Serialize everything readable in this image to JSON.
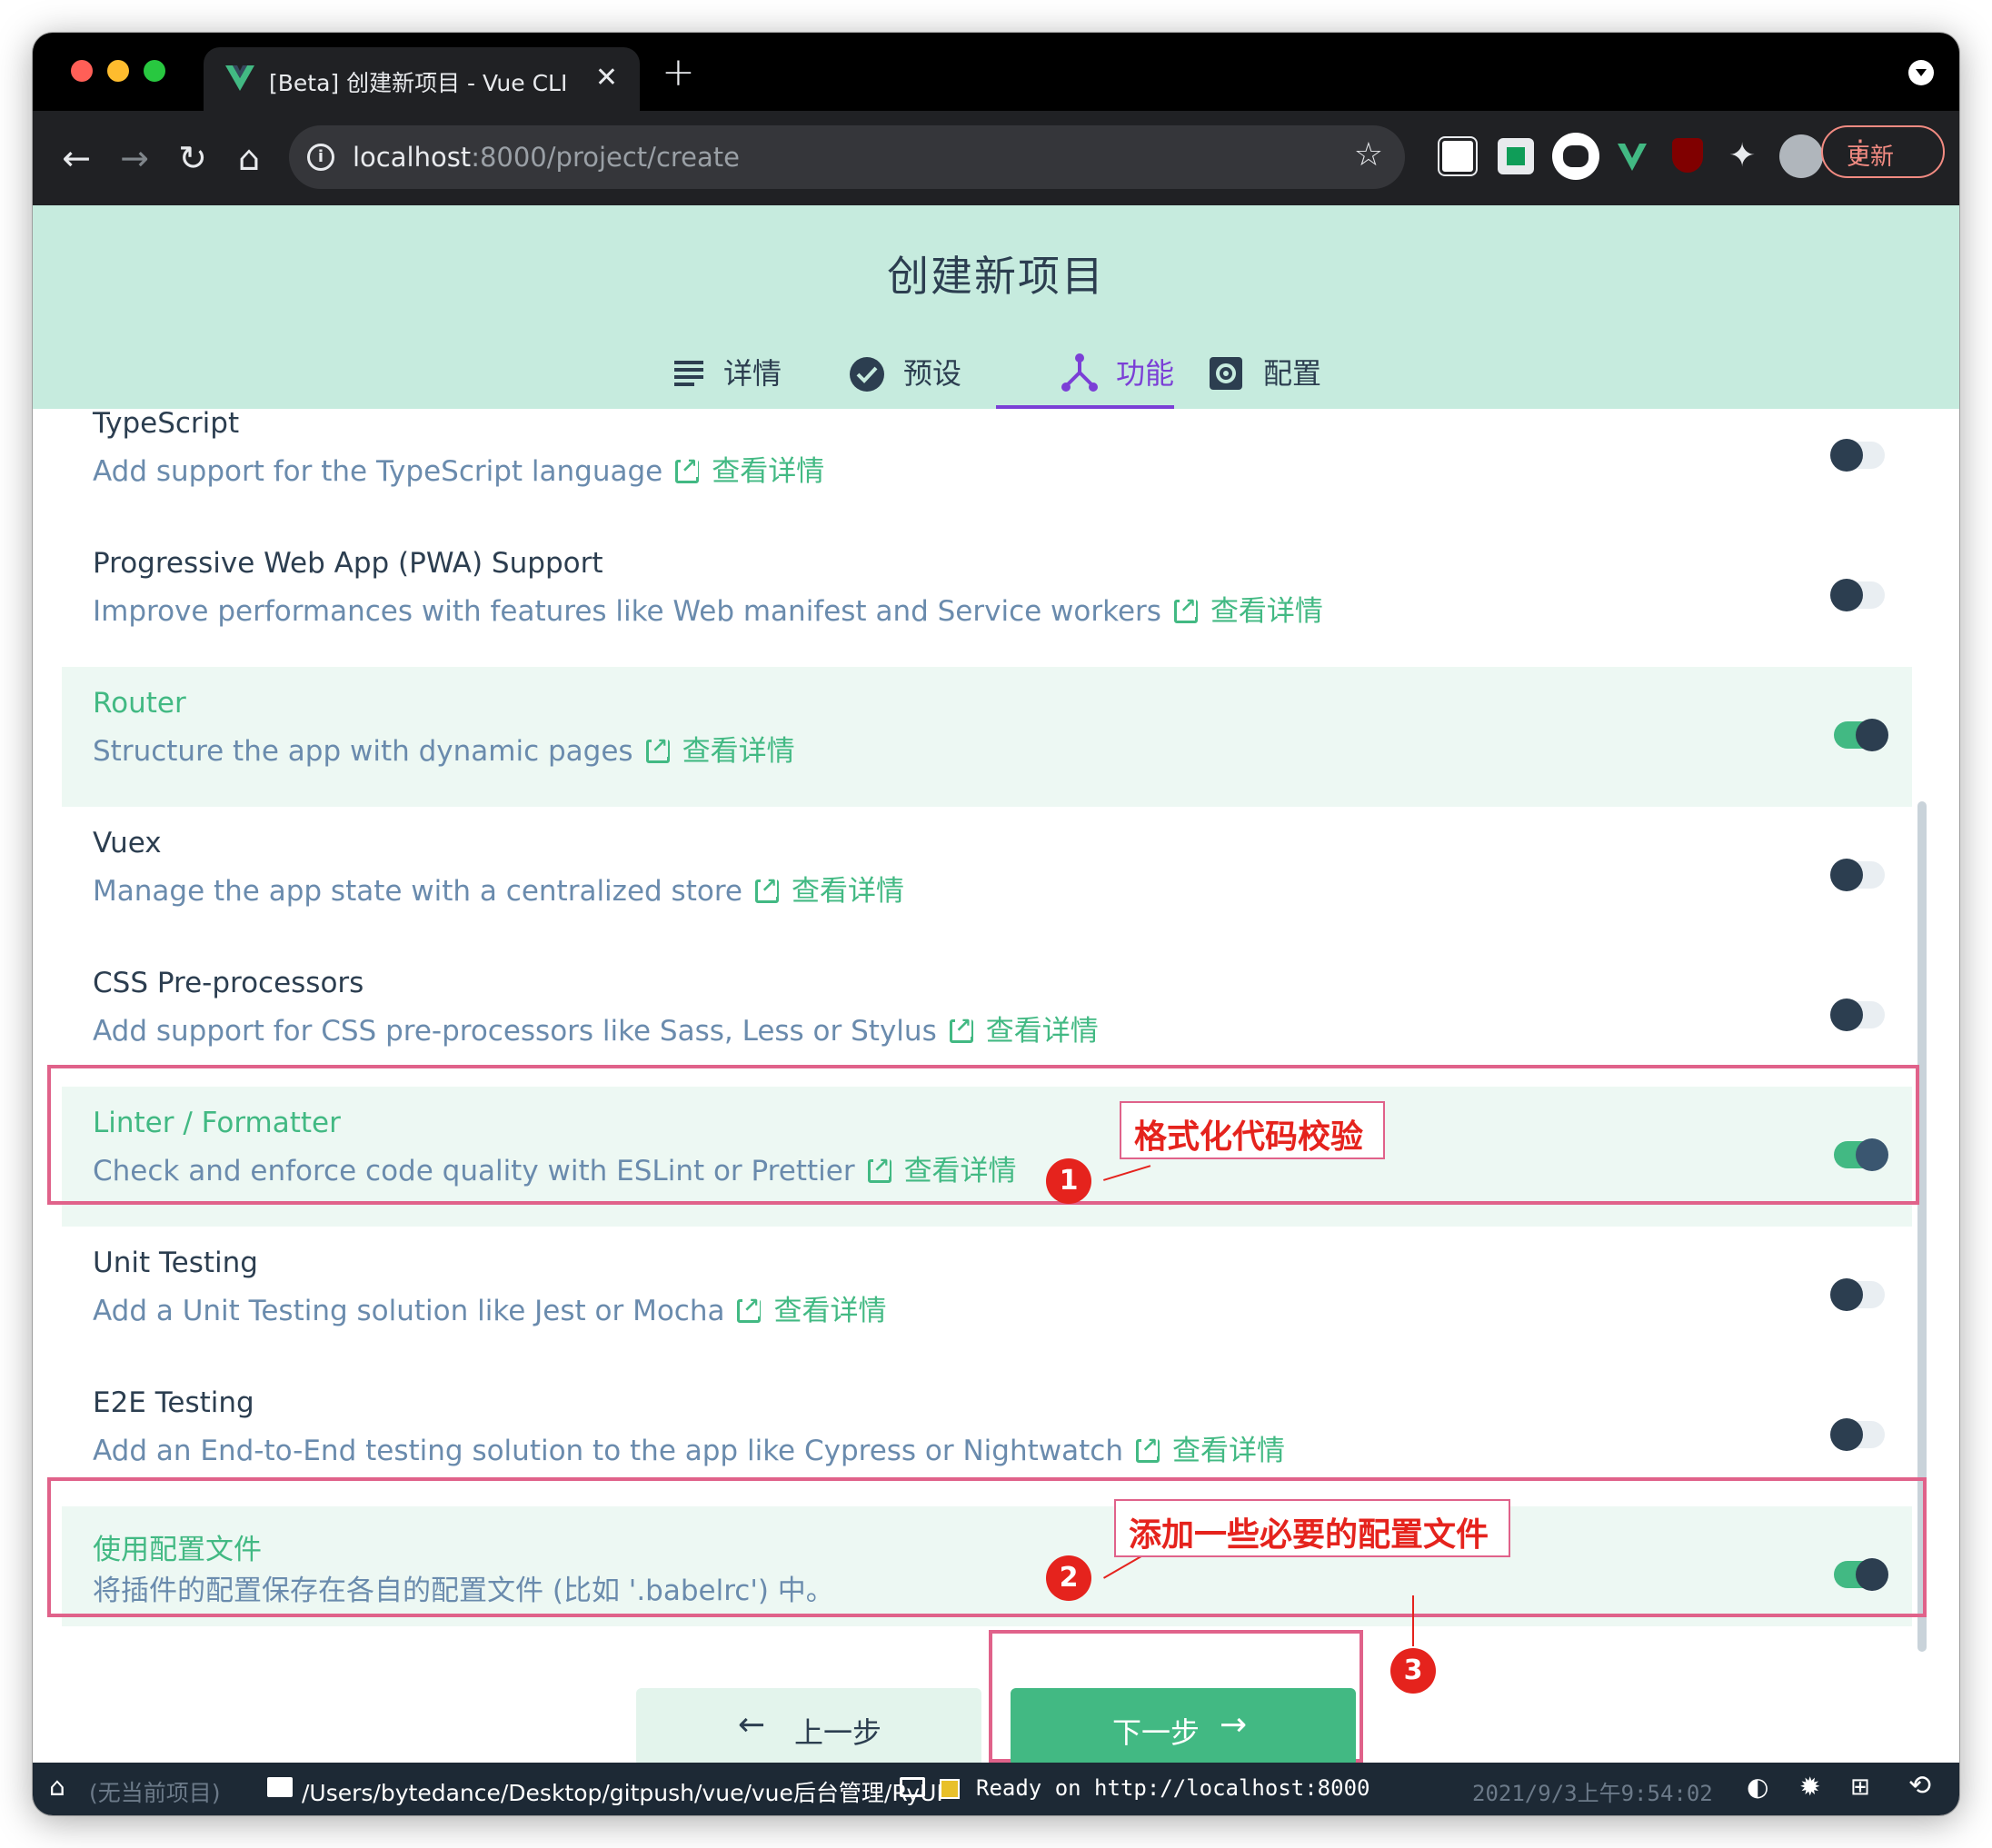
{
  "browser": {
    "tab_title": "[Beta] 创建新项目 - Vue CLI",
    "tab_close": "✕",
    "new_tab": "+",
    "url_host": "localhost",
    "url_path": ":8000/project/create",
    "update_label": "更新",
    "menu_dots": "⋮",
    "icons": [
      "back-icon",
      "forward-icon",
      "reload-icon",
      "home-icon",
      "site-info-icon",
      "bookmark-star-icon",
      "notion-extension-icon",
      "extension-icon",
      "ghost-extension-icon",
      "vue-devtools-icon",
      "ublock-icon",
      "puzzle-icon",
      "profile-avatar-icon"
    ]
  },
  "header": {
    "title": "创建新项目",
    "steps": [
      {
        "label": "详情",
        "icon": "list-icon",
        "active": false
      },
      {
        "label": "预设",
        "icon": "check-circle-icon",
        "active": false
      },
      {
        "label": "功能",
        "icon": "fork-icon",
        "active": true
      },
      {
        "label": "配置",
        "icon": "settings-icon",
        "active": false
      }
    ],
    "accent": "#7b3fd6",
    "background": "#c6ebde"
  },
  "features": {
    "more_label": "查看详情",
    "items": [
      {
        "name": "TypeScript",
        "desc": "Add support for the TypeScript language",
        "enabled": false,
        "link": true
      },
      {
        "name": "Progressive Web App (PWA) Support",
        "desc": "Improve performances with features like Web manifest and Service workers",
        "enabled": false,
        "link": true
      },
      {
        "name": "Router",
        "desc": "Structure the app with dynamic pages",
        "enabled": true,
        "link": true
      },
      {
        "name": "Vuex",
        "desc": "Manage the app state with a centralized store",
        "enabled": false,
        "link": true
      },
      {
        "name": "CSS Pre-processors",
        "desc": "Add support for CSS pre-processors like Sass, Less or Stylus",
        "enabled": false,
        "link": true
      },
      {
        "name": "Linter / Formatter",
        "desc": "Check and enforce code quality with ESLint or Prettier",
        "enabled": true,
        "link": true
      },
      {
        "name": "Unit Testing",
        "desc": "Add a Unit Testing solution like Jest or Mocha",
        "enabled": false,
        "link": true
      },
      {
        "name": "E2E Testing",
        "desc": "Add an End-to-End testing solution to the app like Cypress or Nightwatch",
        "enabled": false,
        "link": true
      },
      {
        "name": "使用配置文件",
        "desc": "将插件的配置保存在各自的配置文件 (比如 '.babelrc') 中。",
        "enabled": true,
        "link": false
      }
    ]
  },
  "annotations": {
    "note1": "格式化代码校验",
    "note2": "添加一些必要的配置文件",
    "badge1": "1",
    "badge2": "2",
    "badge3": "3",
    "color": "#e5231d"
  },
  "actions": {
    "prev_label": "上一步",
    "next_label": "下一步",
    "prev_arrow": "←",
    "next_arrow": "→"
  },
  "statusbar": {
    "project": "(无当前项目)",
    "path": "/Users/bytedance/Desktop/gitpush/vue/vue后台管理/RyUI",
    "log": "Ready on http://localhost:8000",
    "datetime": "2021/9/3上午9:54:02"
  },
  "colors": {
    "vue_green": "#42b983",
    "text_dark": "#2c3e50",
    "desc_blue": "#6a8bad"
  }
}
